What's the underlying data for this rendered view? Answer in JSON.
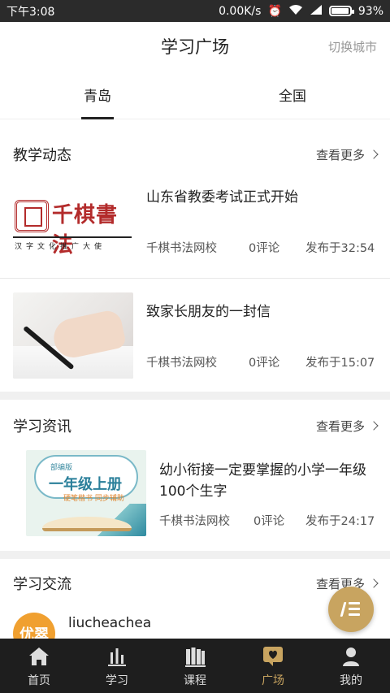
{
  "status_bar": {
    "time": "下午3:08",
    "net_speed": "0.00K/s",
    "battery": "93%"
  },
  "header": {
    "title": "学习广场",
    "switch_city": "切换城市"
  },
  "tabs": [
    {
      "label": "青岛",
      "active": true
    },
    {
      "label": "全国",
      "active": false
    }
  ],
  "sections": {
    "teaching": {
      "title": "教学动态",
      "more": "查看更多",
      "items": [
        {
          "title": "山东省教委考试正式开始",
          "source": "千棋书法网校",
          "comments": "0评论",
          "time": "发布于32:54",
          "thumb_brand": "千棋書法",
          "thumb_sub": "汉字文化推广大使"
        },
        {
          "title": "致家长朋友的一封信",
          "source": "千棋书法网校",
          "comments": "0评论",
          "time": "发布于15:07"
        }
      ]
    },
    "info": {
      "title": "学习资讯",
      "more": "查看更多",
      "items": [
        {
          "title": "幼小衔接一定要掌握的小学一年级100个生字",
          "source": "千棋书法网校",
          "comments": "0评论",
          "time": "发布于24:17",
          "thumb_tag": "部编版",
          "thumb_big": "一年级上册",
          "thumb_sub": "硬笔楷书 同步辅助"
        }
      ]
    },
    "exchange": {
      "title": "学习交流",
      "more": "查看更多",
      "user": {
        "name": "liucheachea",
        "avatar_text": "优翠"
      }
    }
  },
  "bottom_nav": [
    {
      "label": "首页",
      "icon": "home-icon",
      "active": false
    },
    {
      "label": "学习",
      "icon": "chart-icon",
      "active": false
    },
    {
      "label": "课程",
      "icon": "books-icon",
      "active": false
    },
    {
      "label": "广场",
      "icon": "square-chat-icon",
      "active": true
    },
    {
      "label": "我的",
      "icon": "user-icon",
      "active": false
    }
  ],
  "colors": {
    "accent": "#c8a460",
    "nav_bg": "#1e1e1e",
    "brand_red": "#b32b2b"
  }
}
